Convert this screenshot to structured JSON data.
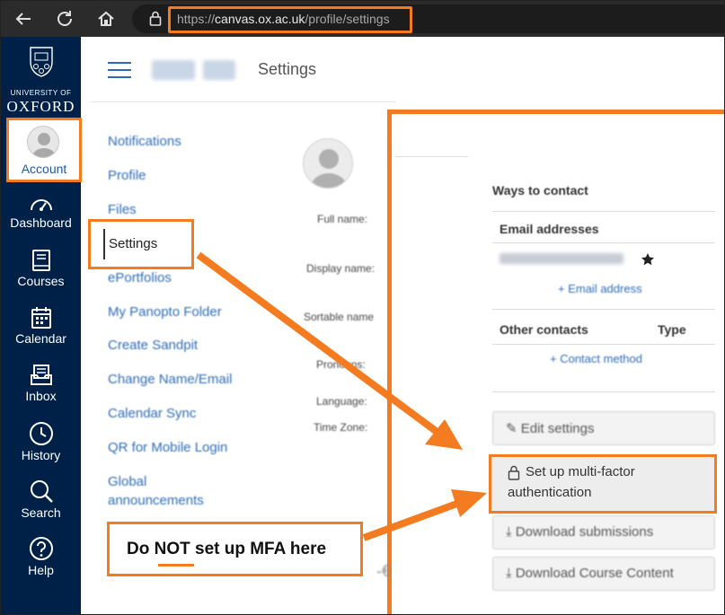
{
  "browser": {
    "url_host": "canvas.ox.ac.uk",
    "url_path": "/profile/settings",
    "url_scheme": "https://"
  },
  "leftnav": {
    "brand_university": "UNIVERSITY OF",
    "brand_name": "OXFORD",
    "items": [
      {
        "label": "Account",
        "icon": "user-avatar"
      },
      {
        "label": "Dashboard",
        "icon": "dashboard-gauge-icon"
      },
      {
        "label": "Courses",
        "icon": "book-icon"
      },
      {
        "label": "Calendar",
        "icon": "calendar-icon"
      },
      {
        "label": "Inbox",
        "icon": "inbox-icon"
      },
      {
        "label": "History",
        "icon": "clock-icon"
      },
      {
        "label": "Search",
        "icon": "search-icon"
      },
      {
        "label": "Help",
        "icon": "question-icon"
      }
    ]
  },
  "header": {
    "title": "Settings"
  },
  "profile_nav": {
    "items": [
      "Notifications",
      "Profile",
      "Files",
      "Settings",
      "ePortfolios",
      "My Panopto Folder",
      "Create Sandpit",
      "Change Name/Email",
      "Calendar Sync",
      "QR for Mobile Login",
      "Global",
      "announcements"
    ]
  },
  "profile_fields": {
    "full_name": "Full name:",
    "display_name": "Display name:",
    "sortable_name": "Sortable name",
    "pronouns": "Pronouns:",
    "language": "Language:",
    "time_zone": "Time Zone:"
  },
  "contact_panel": {
    "heading": "Ways to contact",
    "email_heading": "Email addresses",
    "add_email": "+ Email address",
    "other_contacts": "Other contacts",
    "type_col": "Type",
    "add_contact": "+ Contact method"
  },
  "actions": {
    "edit_settings": "Edit settings",
    "mfa_line1": "Set up multi-factor",
    "mfa_line2": "authentication",
    "download_submissions": "Download submissions",
    "download_course_content": "Download Course Content"
  },
  "callout": {
    "pre": "Do ",
    "emph": "NOT",
    "post": " set up MFA here"
  },
  "colors": {
    "accent_orange": "#f47b20",
    "nav_bg": "#002147",
    "link_blue": "#2d6cb5"
  }
}
